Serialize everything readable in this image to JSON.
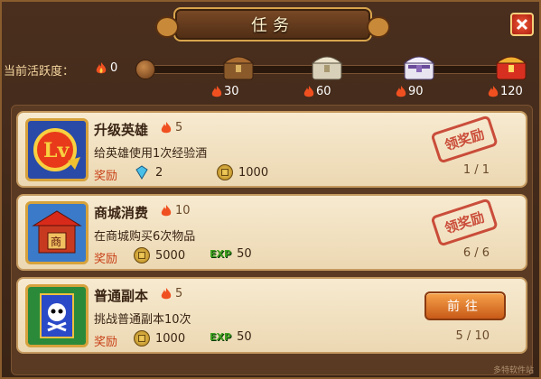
{
  "title": "任务",
  "activity": {
    "label": "当前活跃度：",
    "value": "0",
    "progress_fraction": 0.0
  },
  "milestones": [
    {
      "points": "30",
      "chest": "bronze-chest-icon"
    },
    {
      "points": "60",
      "chest": "silver-chest-icon"
    },
    {
      "points": "90",
      "chest": "purple-chest-icon"
    },
    {
      "points": "120",
      "chest": "gold-chest-icon"
    }
  ],
  "tasks": [
    {
      "name": "升级英雄",
      "points": "5",
      "desc": "给英雄使用1次经验酒",
      "reward_label": "奖励",
      "reward1": "2",
      "reward2": "1000",
      "progress": "1 / 1",
      "status": "领奖励"
    },
    {
      "name": "商城消费",
      "points": "10",
      "desc": "在商城购买6次物品",
      "reward_label": "奖励",
      "reward1": "5000",
      "reward2": "50",
      "progress": "6 / 6",
      "status": "领奖励"
    },
    {
      "name": "普通副本",
      "points": "5",
      "desc": "挑战普通副本10次",
      "reward_label": "奖励",
      "reward1": "1000",
      "reward2": "50",
      "progress": "5 / 10",
      "action": "前往"
    }
  ],
  "colors": {
    "accent": "#c84018",
    "title_plate": "#7a4a26",
    "card_bg": "#f7ead0"
  },
  "watermark": "多特软件站"
}
